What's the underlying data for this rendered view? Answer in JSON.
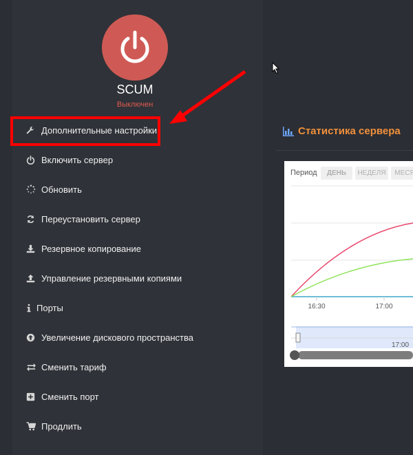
{
  "server": {
    "name": "SCUM",
    "status": "Выключен"
  },
  "menu": {
    "items": [
      {
        "label": "Дополнительные настройки",
        "icon": "wrench-icon"
      },
      {
        "label": "Включить сервер",
        "icon": "power-icon"
      },
      {
        "label": "Обновить",
        "icon": "spinner-icon"
      },
      {
        "label": "Переустановить сервер",
        "icon": "refresh-icon"
      },
      {
        "label": "Резервное копирование",
        "icon": "download-icon"
      },
      {
        "label": "Управление резервными копиями",
        "icon": "upload-icon"
      },
      {
        "label": "Порты",
        "icon": "info-icon"
      },
      {
        "label": "Увеличение дискового пространства",
        "icon": "arrow-up-circle-icon"
      },
      {
        "label": "Сменить тариф",
        "icon": "exchange-icon"
      },
      {
        "label": "Сменить порт",
        "icon": "plus-square-icon"
      },
      {
        "label": "Продлить",
        "icon": "cart-icon"
      }
    ]
  },
  "stats": {
    "title": "Статистика сервера",
    "period_label": "Период",
    "periods": [
      "ДЕНЬ",
      "НЕДЕЛЯ",
      "МЕСЯ"
    ],
    "x_ticks": [
      "16:30",
      "17:00"
    ],
    "navigator_tick": "17:00"
  },
  "colors": {
    "accent": "#f1903b",
    "highlight": "#ff0000",
    "status_off": "#e05a4f",
    "series_red": "#e8456b",
    "series_green": "#8fe35a",
    "series_blue": "#3ea7c9"
  }
}
